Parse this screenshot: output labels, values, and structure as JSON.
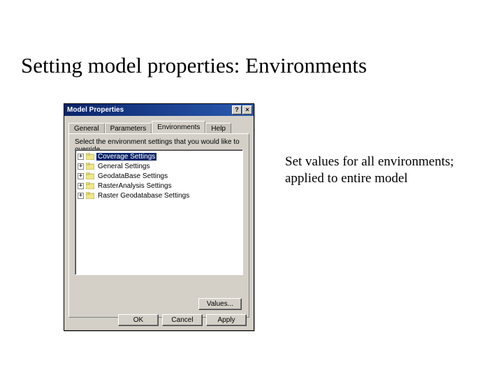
{
  "slide": {
    "title": "Setting model properties: Environments",
    "annotation": "Set values for all environments; applied to entire model"
  },
  "dialog": {
    "title": "Model Properties",
    "help_btn": "?",
    "close_btn": "×",
    "tabs": {
      "general": "General",
      "parameters": "Parameters",
      "environments": "Environments",
      "help": "Help"
    },
    "instruction": "Select the environment settings that you would like to override.",
    "tree": [
      {
        "label": "Coverage Settings",
        "selected": true
      },
      {
        "label": "General Settings",
        "selected": false
      },
      {
        "label": "GeodataBase Settings",
        "selected": false
      },
      {
        "label": "RasterAnalysis Settings",
        "selected": false
      },
      {
        "label": "Raster Geodatabase Settings",
        "selected": false
      }
    ],
    "values_btn": "Values...",
    "buttons": {
      "ok": "OK",
      "cancel": "Cancel",
      "apply": "Apply"
    }
  }
}
